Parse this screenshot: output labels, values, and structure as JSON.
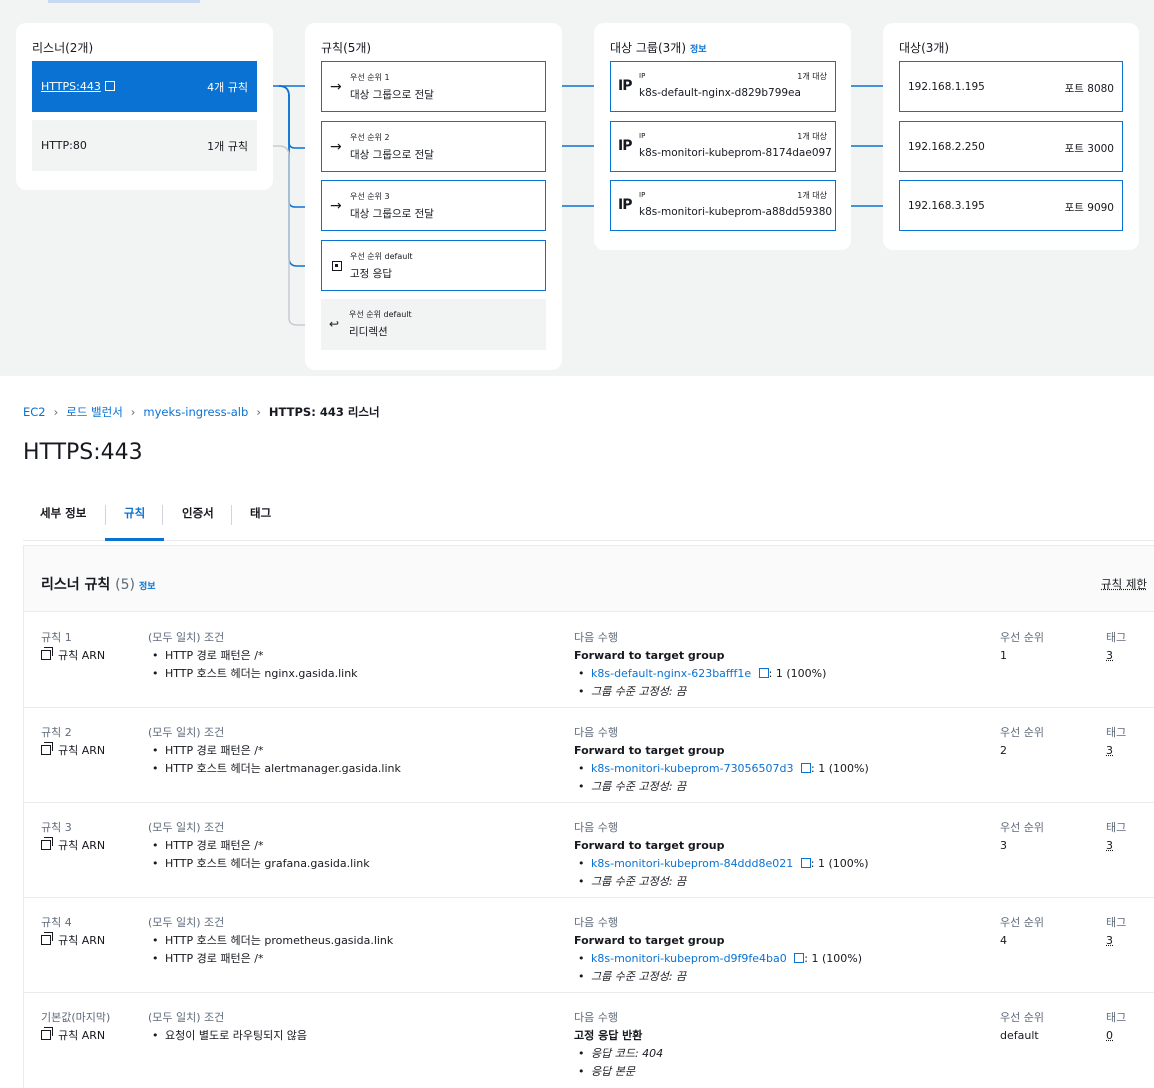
{
  "map": {
    "listeners_title": "리스너(2개)",
    "rules_title": "규칙(5개)",
    "tg_title": "대상 그룹(3개)",
    "tg_info": "정보",
    "targets_title": "대상(3개)",
    "listeners": [
      {
        "name": "HTTPS:443",
        "rules": "4개 규칙"
      },
      {
        "name": "HTTP:80",
        "rules": "1개 규칙"
      }
    ],
    "rules": [
      {
        "priority": "우선 순위 1",
        "action": "대상 그룹으로 전달"
      },
      {
        "priority": "우선 순위 2",
        "action": "대상 그룹으로 전달"
      },
      {
        "priority": "우선 순위 3",
        "action": "대상 그룹으로 전달"
      },
      {
        "priority": "우선 순위 default",
        "action": "고정 응답"
      },
      {
        "priority": "우선 순위 default",
        "action": "리디렉션"
      }
    ],
    "target_groups": [
      {
        "type": "IP",
        "count": "1개 대상",
        "name": "k8s-default-nginx-d829b799ea"
      },
      {
        "type": "IP",
        "count": "1개 대상",
        "name": "k8s-monitori-kubeprom-8174dae097"
      },
      {
        "type": "IP",
        "count": "1개 대상",
        "name": "k8s-monitori-kubeprom-a88dd59380"
      }
    ],
    "targets": [
      {
        "ip": "192.168.1.195",
        "port": "포트 8080"
      },
      {
        "ip": "192.168.2.250",
        "port": "포트 3000"
      },
      {
        "ip": "192.168.3.195",
        "port": "포트 9090"
      }
    ]
  },
  "breadcrumb": [
    "EC2",
    "로드 밸런서",
    "myeks-ingress-alb",
    "HTTPS: 443 리스너"
  ],
  "page_title": "HTTPS:443",
  "tabs": [
    "세부 정보",
    "규칙",
    "인증서",
    "태그"
  ],
  "panel": {
    "title": "리스너 규칙",
    "count": "(5)",
    "info": "정보",
    "limit_link": "규칙 제한"
  },
  "columns": {
    "conditions": "(모두 일치) 조건",
    "action": "다음 수행",
    "priority": "우선 순위",
    "tags": "태그",
    "arn": "규칙 ARN"
  },
  "rules": [
    {
      "name": "규칙 1",
      "conditions": [
        "HTTP 경로 패턴은 /*",
        "HTTP 호스트 헤더는 nginx.gasida.link"
      ],
      "action_title": "Forward to target group",
      "tg_link": "k8s-default-nginx-623bafff1e",
      "tg_weight": ": 1 (100%)",
      "stickiness": "그룹 수준 고정성: 끔",
      "priority": "1",
      "tags": "3"
    },
    {
      "name": "규칙 2",
      "conditions": [
        "HTTP 경로 패턴은 /*",
        "HTTP 호스트 헤더는 alertmanager.gasida.link"
      ],
      "action_title": "Forward to target group",
      "tg_link": "k8s-monitori-kubeprom-73056507d3",
      "tg_weight": ": 1 (100%)",
      "stickiness": "그룹 수준 고정성: 끔",
      "priority": "2",
      "tags": "3"
    },
    {
      "name": "규칙 3",
      "conditions": [
        "HTTP 경로 패턴은 /*",
        "HTTP 호스트 헤더는 grafana.gasida.link"
      ],
      "action_title": "Forward to target group",
      "tg_link": "k8s-monitori-kubeprom-84ddd8e021",
      "tg_weight": ": 1 (100%)",
      "stickiness": "그룹 수준 고정성: 끔",
      "priority": "3",
      "tags": "3"
    },
    {
      "name": "규칙 4",
      "conditions": [
        "HTTP 호스트 헤더는 prometheus.gasida.link",
        "HTTP 경로 패턴은 /*"
      ],
      "action_title": "Forward to target group",
      "tg_link": "k8s-monitori-kubeprom-d9f9fe4ba0",
      "tg_weight": ": 1 (100%)",
      "stickiness": "그룹 수준 고정성: 끔",
      "priority": "4",
      "tags": "3"
    }
  ],
  "default_rule": {
    "name": "기본값(마지막)",
    "condition": "요청이 별도로 라우팅되지 않음",
    "action_title": "고정 응답 반환",
    "details": [
      "응답 코드: 404",
      "응답 본문"
    ],
    "priority": "default",
    "tags": "0"
  },
  "colors": {
    "accent": "#0972d3",
    "map_bg": "#f2f3f3",
    "connector_dim": "#c7ccd1"
  }
}
